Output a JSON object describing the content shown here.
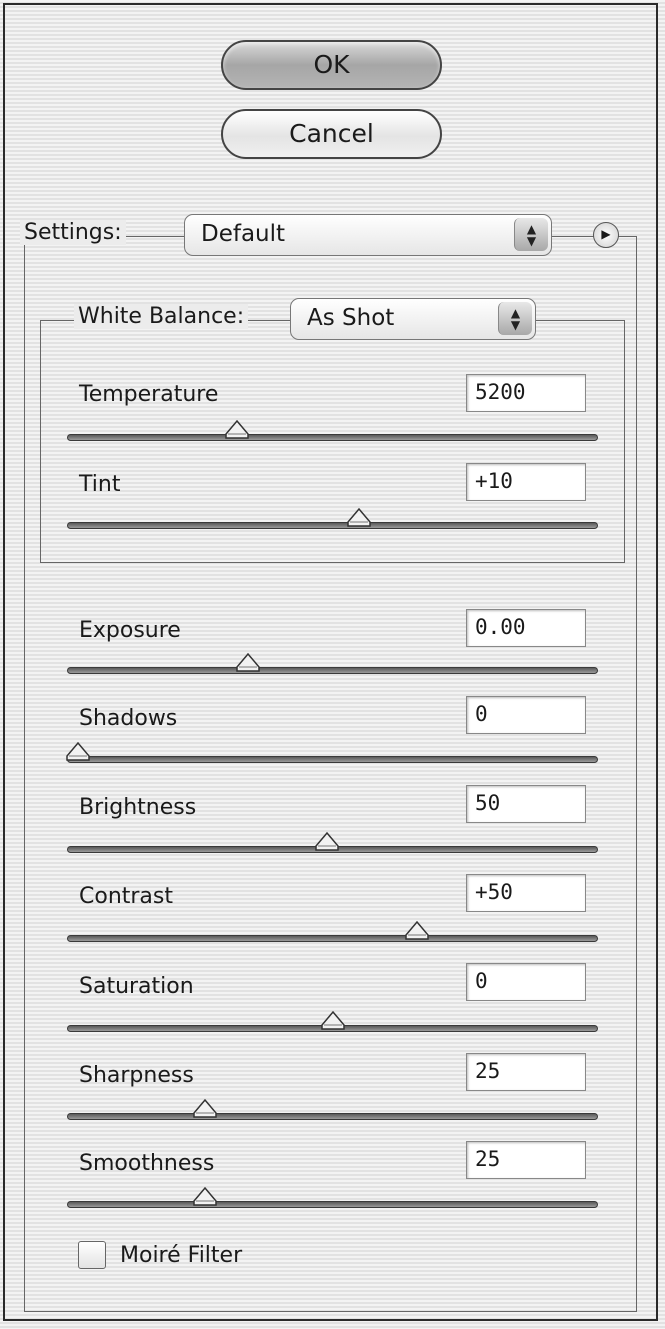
{
  "buttons": {
    "ok_label": "OK",
    "cancel_label": "Cancel"
  },
  "settings": {
    "label": "Settings:",
    "value": "Default",
    "menu_icon": "play-arrow-icon"
  },
  "white_balance": {
    "label": "White Balance:",
    "value": "As Shot"
  },
  "sliders": {
    "temperature": {
      "label": "Temperature",
      "value": "5200",
      "position": 0.32
    },
    "tint": {
      "label": "Tint",
      "value": "+10",
      "position": 0.55
    },
    "exposure": {
      "label": "Exposure",
      "value": "0.00",
      "position": 0.34
    },
    "shadows": {
      "label": "Shadows",
      "value": "0",
      "position": 0.02
    },
    "brightness": {
      "label": "Brightness",
      "value": "50",
      "position": 0.49
    },
    "contrast": {
      "label": "Contrast",
      "value": "+50",
      "position": 0.66
    },
    "saturation": {
      "label": "Saturation",
      "value": "0",
      "position": 0.5
    },
    "sharpness": {
      "label": "Sharpness",
      "value": "25",
      "position": 0.26
    },
    "smoothness": {
      "label": "Smoothness",
      "value": "25",
      "position": 0.26
    }
  },
  "moire": {
    "label": "Moiré Filter",
    "checked": false
  }
}
